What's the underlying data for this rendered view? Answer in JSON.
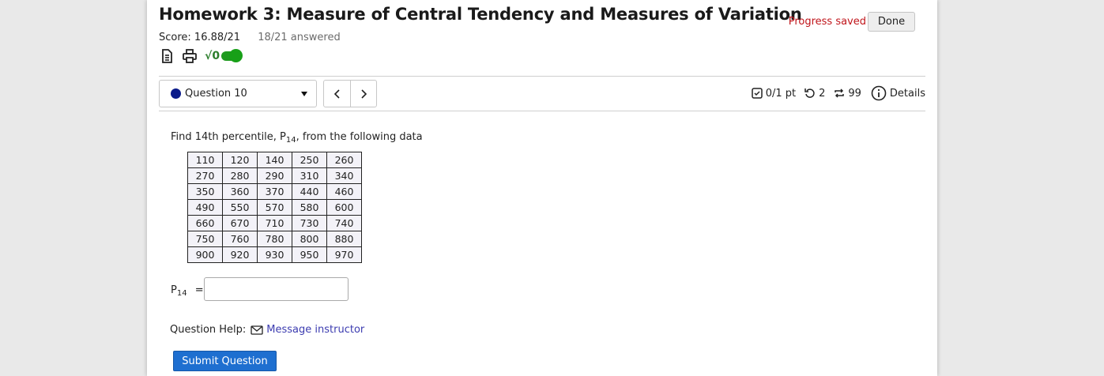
{
  "header": {
    "title": "Homework 3: Measure of Central Tendency and Measures of Variation",
    "score": "Score: 16.88/21",
    "answered": "18/21 answered",
    "progress_status": "Progress saved",
    "done_label": "Done",
    "tools": [
      "document-icon",
      "print-icon",
      "sqrt-toggle-icon"
    ],
    "sqrt_label": "√0"
  },
  "question_nav": {
    "selected": "Question 10",
    "prev_glyph": "‹",
    "next_glyph": "›"
  },
  "meta": {
    "points": "0/1 pt",
    "retries": "2",
    "attempts": "99",
    "details": "Details"
  },
  "question": {
    "prompt_before": "Find 14th percentile, P",
    "prompt_sub": "14",
    "prompt_after": ",  from the following data",
    "table": [
      [
        "110",
        "120",
        "140",
        "250",
        "260"
      ],
      [
        "270",
        "280",
        "290",
        "310",
        "340"
      ],
      [
        "350",
        "360",
        "370",
        "440",
        "460"
      ],
      [
        "490",
        "550",
        "570",
        "580",
        "600"
      ],
      [
        "660",
        "670",
        "710",
        "730",
        "740"
      ],
      [
        "750",
        "760",
        "780",
        "800",
        "880"
      ],
      [
        "900",
        "920",
        "930",
        "950",
        "970"
      ]
    ],
    "answer_label": "P",
    "answer_sub": "14",
    "answer_eq": "=",
    "answer_value": ""
  },
  "help": {
    "label": "Question Help:",
    "message_link": "Message instructor"
  },
  "submit_label": "Submit Question",
  "colors": {
    "progress_text": "#c0141a",
    "submit_bg": "#1e6fd0",
    "link": "#3c3cb0",
    "question_dot": "#0a1a8a",
    "toggle": "#1f9a1f"
  }
}
